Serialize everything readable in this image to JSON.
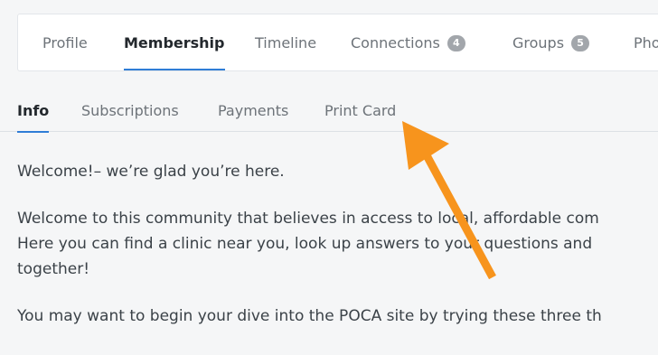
{
  "main_tabs": [
    {
      "label": "Profile",
      "active": false
    },
    {
      "label": "Membership",
      "active": true
    },
    {
      "label": "Timeline",
      "active": false
    },
    {
      "label": "Connections",
      "badge": "4",
      "active": false
    },
    {
      "label": "Groups",
      "badge": "5",
      "active": false
    },
    {
      "label": "Pho",
      "active": false
    }
  ],
  "sub_tabs": [
    {
      "label": "Info",
      "active": true
    },
    {
      "label": "Subscriptions",
      "active": false
    },
    {
      "label": "Payments",
      "active": false
    },
    {
      "label": "Print Card",
      "active": false
    }
  ],
  "content": {
    "welcome": "Welcome!– we’re glad you’re here.",
    "para_line1": "Welcome to this community that believes in access to local, affordable com",
    "para_line2": "Here you can find a clinic near you, look up answers to your questions and",
    "para_line3": "together!",
    "para_next": "You may want to begin your dive into the POCA site by trying these three th"
  },
  "colors": {
    "accent": "#2f7dd6",
    "arrow": "#f7941d"
  },
  "icons": {
    "annotation": "arrow-pointing-icon"
  }
}
